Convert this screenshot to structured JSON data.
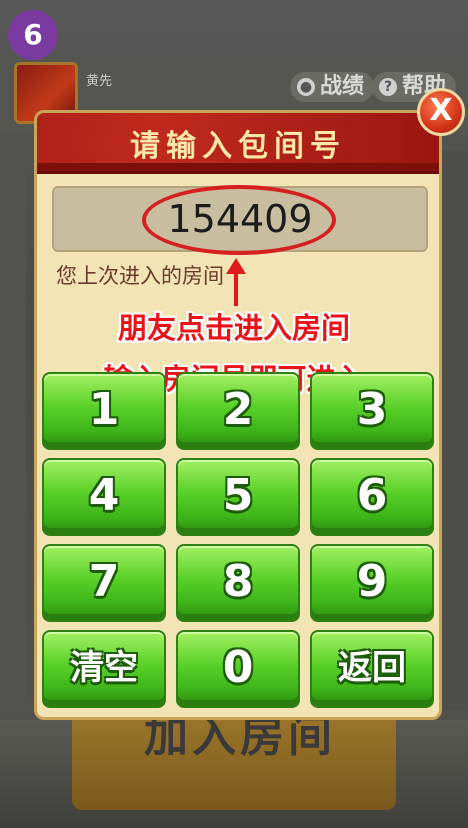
{
  "step_badge": "6",
  "background": {
    "player_name": "黄先",
    "record_label": "战绩",
    "help_label": "帮助",
    "join_room_label": "加入房间"
  },
  "dialog": {
    "title": "请输入包间号",
    "close_label": "X",
    "room_number": "154409",
    "last_room_label": "您上次进入的房间"
  },
  "annotation": {
    "line1": "朋友点击进入房间",
    "line2": "输入房间号即可进入"
  },
  "keypad": {
    "keys": [
      "1",
      "2",
      "3",
      "4",
      "5",
      "6",
      "7",
      "8",
      "9",
      "清空",
      "0",
      "返回"
    ]
  },
  "colors": {
    "header_red": "#b8201a",
    "key_green": "#58d028",
    "annotation_red": "#e8141a",
    "badge_purple": "#7a3aa0"
  }
}
